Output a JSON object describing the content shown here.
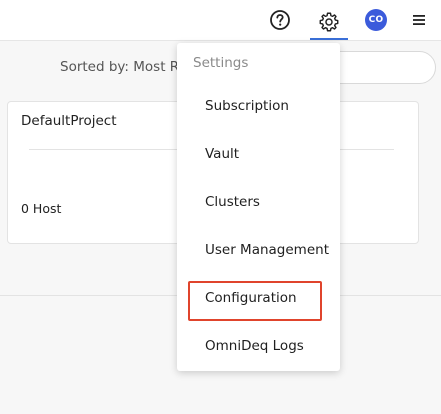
{
  "topbar": {
    "icons": {
      "help": "help-circle-icon",
      "settings": "gear-icon",
      "menu": "hamburger-menu-icon"
    },
    "avatar_initials": "CO",
    "accent_color": "#3a6fd8",
    "avatar_color": "#3b5bdb"
  },
  "toolbar": {
    "sorted_label": "Sorted by: Most R"
  },
  "project_card": {
    "title": "DefaultProject",
    "host_count": "0 Host"
  },
  "settings_menu": {
    "header": "Settings",
    "items": [
      {
        "label": "Subscription"
      },
      {
        "label": "Vault"
      },
      {
        "label": "Clusters"
      },
      {
        "label": "User Management"
      },
      {
        "label": "Configuration"
      },
      {
        "label": "OmniDeq Logs"
      }
    ],
    "highlight_color": "#e0442c"
  }
}
